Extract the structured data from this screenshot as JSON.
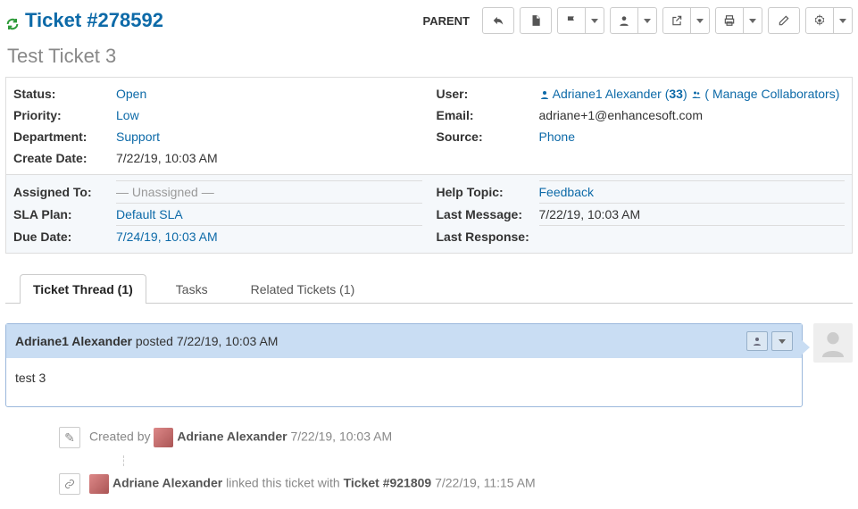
{
  "header": {
    "ticket_label": "Ticket #278592",
    "parent_label": "PARENT"
  },
  "subject": "Test Ticket 3",
  "meta1_left": {
    "status_label": "Status:",
    "status": "Open",
    "priority_label": "Priority:",
    "priority": "Low",
    "dept_label": "Department:",
    "dept": "Support",
    "created_label": "Create Date:",
    "created": "7/22/19, 10:03 AM"
  },
  "meta1_right": {
    "user_label": "User:",
    "user_name": "Adriane1 Alexander",
    "user_count": "33",
    "collab_label": "( Manage Collaborators)",
    "email_label": "Email:",
    "email": "adriane+1@enhancesoft.com",
    "source_label": "Source:",
    "source": "Phone"
  },
  "meta2_left": {
    "assigned_label": "Assigned To:",
    "assigned": "— Unassigned —",
    "sla_label": "SLA Plan:",
    "sla": "Default SLA",
    "due_label": "Due Date:",
    "due": "7/24/19, 10:03 AM"
  },
  "meta2_right": {
    "topic_label": "Help Topic:",
    "topic": "Feedback",
    "lastmsg_label": "Last Message:",
    "lastmsg": "7/22/19, 10:03 AM",
    "lastresp_label": "Last Response:",
    "lastresp": ""
  },
  "tabs": {
    "thread": "Ticket Thread (1)",
    "tasks": "Tasks",
    "related": "Related Tickets (1)"
  },
  "thread": {
    "author": "Adriane1 Alexander",
    "action": " posted ",
    "time": "7/22/19, 10:03 AM",
    "body": "test 3"
  },
  "events": {
    "created_prefix": "Created by ",
    "created_name": "Adriane Alexander",
    "created_time": "7/22/19, 10:03 AM",
    "linked_name": "Adriane Alexander",
    "linked_mid": " linked this ticket with ",
    "linked_ticket": "Ticket #921809",
    "linked_time": "7/22/19, 11:15 AM"
  }
}
